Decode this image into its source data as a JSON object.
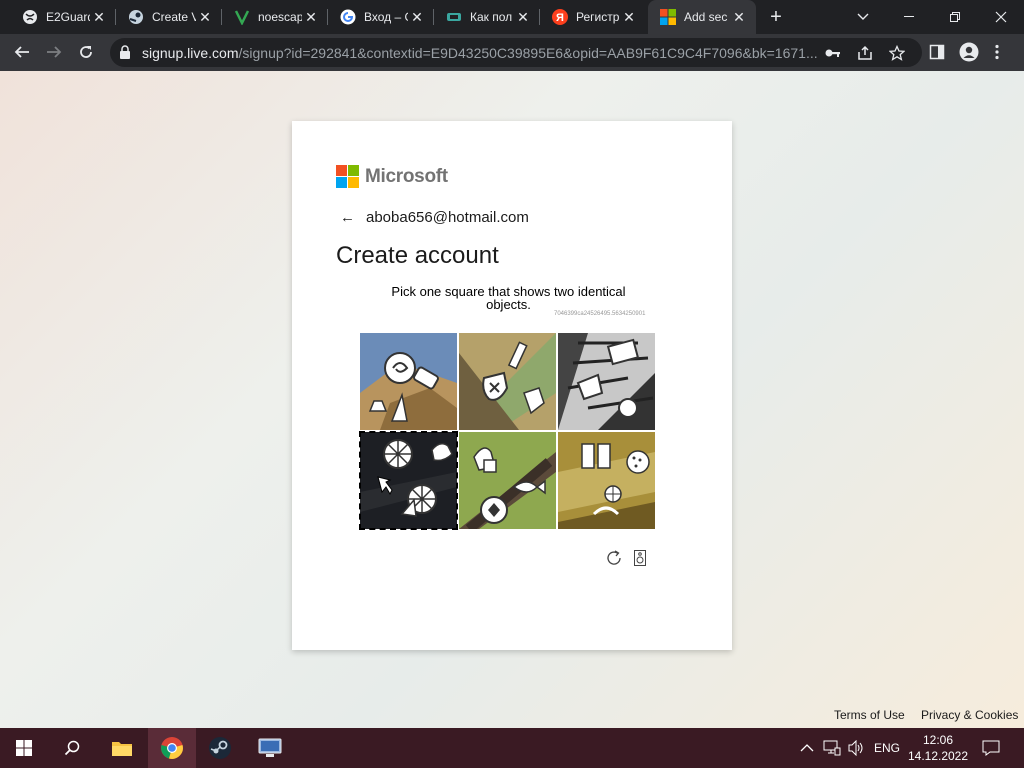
{
  "browser": {
    "tabs": [
      {
        "title": "E2Guard",
        "icon": "globe-icon",
        "active": false
      },
      {
        "title": "Create V",
        "icon": "steam-icon",
        "active": false
      },
      {
        "title": "noescap",
        "icon": "v-logo-icon",
        "active": false
      },
      {
        "title": "Вход – G",
        "icon": "google-icon",
        "active": false
      },
      {
        "title": "Как пол",
        "icon": "site-icon",
        "active": false
      },
      {
        "title": "Регистр",
        "icon": "yandex-icon",
        "active": false
      },
      {
        "title": "Add sec",
        "icon": "microsoft-icon",
        "active": true
      }
    ],
    "new_tab_symbol": "+",
    "url_host": "signup.live.com",
    "url_path": "/signup?id=292841&contextid=E9D43250C39895E6&opid=AAB9F61C9C4F7096&bk=1671..."
  },
  "page": {
    "brand": "Microsoft",
    "brand_colors": [
      "#f25022",
      "#7fba00",
      "#00a4ef",
      "#ffb900"
    ],
    "back_arrow": "←",
    "email": "aboba656@hotmail.com",
    "title": "Create account",
    "instruction": "Pick one square that shows two identical objects.",
    "token": "7046399ca24526495.5634250901",
    "captcha_tiles": [
      {
        "index": 0,
        "selected": false
      },
      {
        "index": 1,
        "selected": false
      },
      {
        "index": 2,
        "selected": false
      },
      {
        "index": 3,
        "selected": true
      },
      {
        "index": 4,
        "selected": false
      },
      {
        "index": 5,
        "selected": false
      }
    ],
    "footer": {
      "terms": "Terms of Use",
      "privacy": "Privacy & Cookies"
    }
  },
  "taskbar": {
    "apps": [
      "windows-start-icon",
      "search-icon",
      "file-explorer-icon",
      "chrome-icon",
      "steam-icon",
      "network-app-icon"
    ],
    "language": "ENG",
    "time": "12:06",
    "date": "14.12.2022"
  }
}
